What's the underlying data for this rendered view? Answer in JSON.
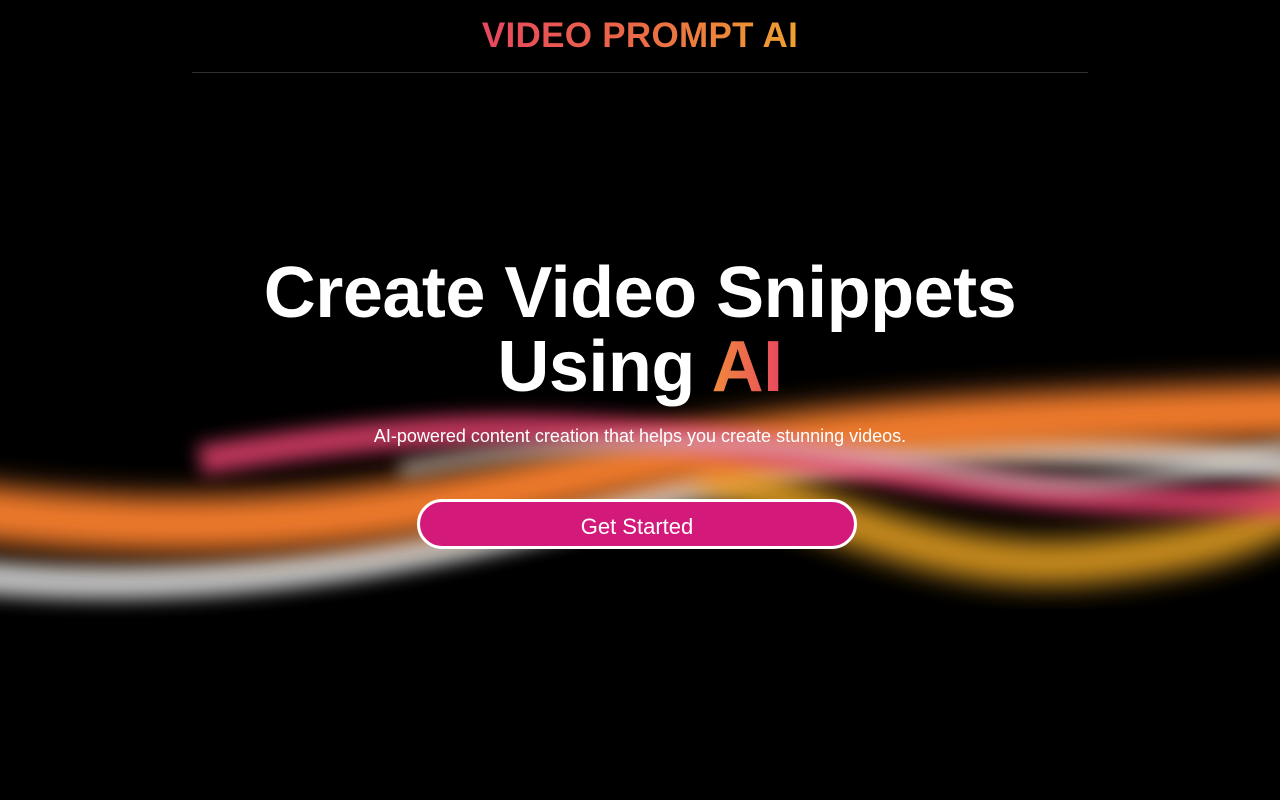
{
  "header": {
    "brand": "VIDEO PROMPT AI"
  },
  "hero": {
    "title_line1": "Create Video Snippets",
    "title_line2_prefix": "Using ",
    "title_line2_accent": "AI",
    "subtitle": "AI-powered content creation that helps you create stunning videos."
  },
  "cta": {
    "label": "Get Started"
  },
  "colors": {
    "background": "#000000",
    "brand_gradient_start": "#e8475f",
    "brand_gradient_end": "#f0a030",
    "button": "#d3197a",
    "wave_orange": "#f07a2a",
    "wave_pink": "#e0406a",
    "wave_gray": "#c8c8c8",
    "wave_gold": "#e8a020"
  }
}
